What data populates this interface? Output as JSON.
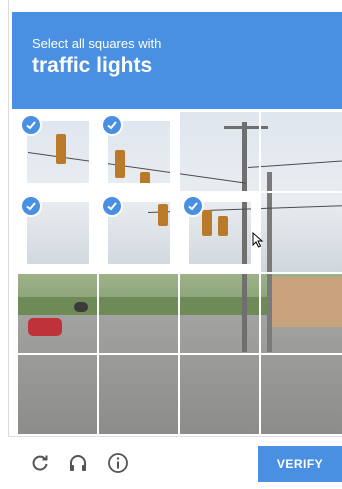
{
  "header": {
    "instruction": "Select all squares with",
    "target": "traffic lights"
  },
  "grid": {
    "rows": 4,
    "cols": 4,
    "selected_tiles": [
      {
        "row": 0,
        "col": 0
      },
      {
        "row": 0,
        "col": 1
      },
      {
        "row": 1,
        "col": 0
      },
      {
        "row": 1,
        "col": 1
      },
      {
        "row": 1,
        "col": 2
      }
    ]
  },
  "footer": {
    "reload_icon": "reload-icon",
    "audio_icon": "headphones-icon",
    "info_icon": "info-icon",
    "verify_label": "VERIFY"
  },
  "colors": {
    "accent": "#4a90e2"
  }
}
